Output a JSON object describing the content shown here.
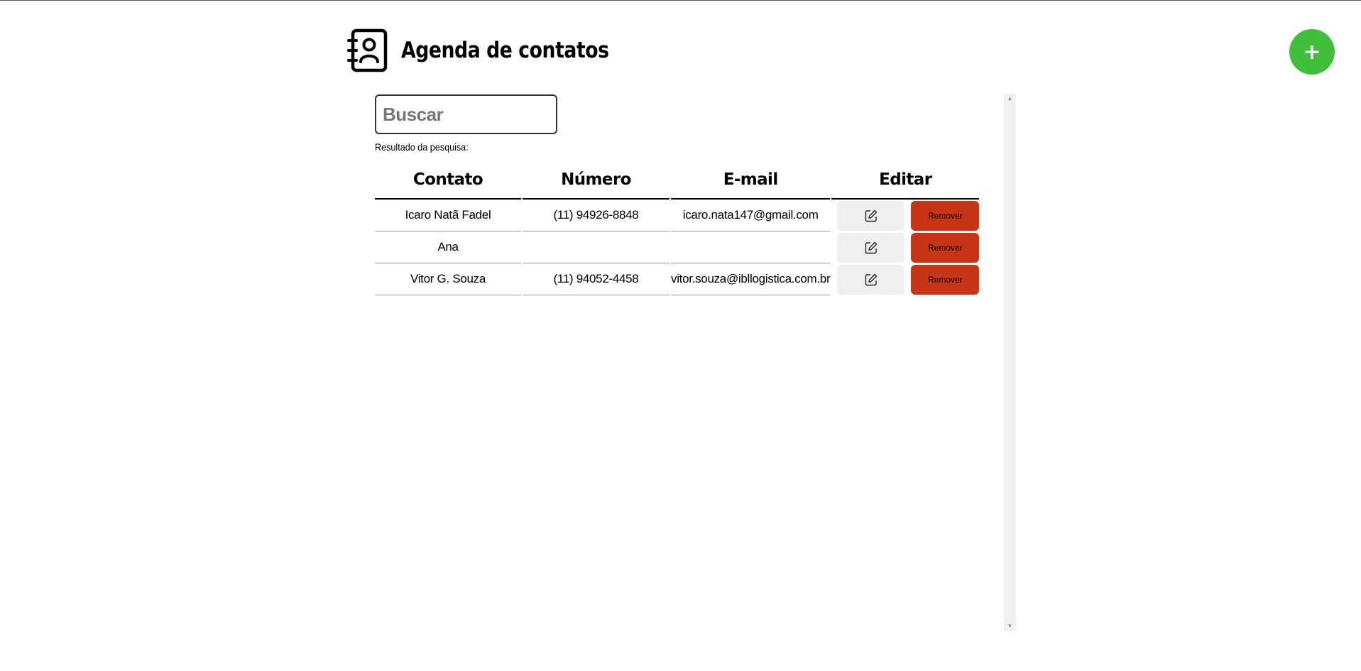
{
  "app": {
    "title": "Agenda de contatos",
    "icon": "address-book-icon",
    "add_button_label": "+",
    "accent_color": "#3fbf3c",
    "danger_color": "#c83516"
  },
  "search": {
    "placeholder": "Buscar",
    "value": "",
    "results_label": "Resultado da pesquisa:"
  },
  "table": {
    "headers": {
      "contato": "Contato",
      "numero": "Número",
      "email": "E-mail",
      "editar": "Editar"
    },
    "rows": [
      {
        "contato": "Icaro Natã Fadel",
        "numero": "(11) 94926-8848",
        "email": "icaro.nata147@gmail.com",
        "edit_icon": "edit-icon",
        "remove_label": "Remover"
      },
      {
        "contato": "Ana",
        "numero": "",
        "email": "",
        "edit_icon": "edit-icon",
        "remove_label": "Remover"
      },
      {
        "contato": "Vitor G. Souza",
        "numero": "(11) 94052-4458",
        "email": "vitor.souza@ibllogistica.com.br",
        "edit_icon": "edit-icon",
        "remove_label": "Remover"
      }
    ]
  }
}
